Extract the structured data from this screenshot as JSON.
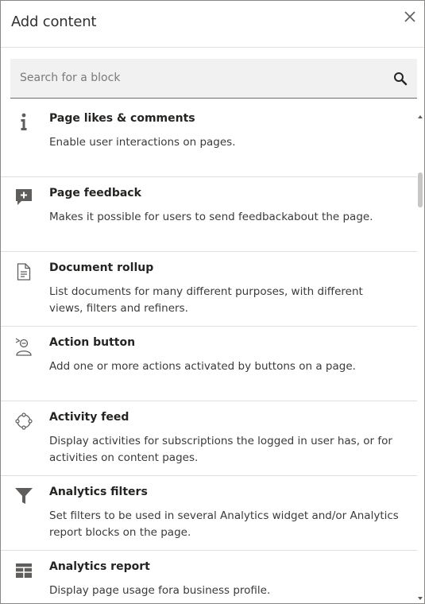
{
  "dialog": {
    "title": "Add content",
    "close_icon": "close-icon"
  },
  "search": {
    "placeholder": "Search for a block",
    "value": "",
    "icon": "search-icon"
  },
  "blocks": [
    {
      "name": "Page likes & comments",
      "description": "Enable user interactions on pages.",
      "icon": "info-icon"
    },
    {
      "name": "Page feedback",
      "description": "Makes it possible for users to send feedbackabout the page.",
      "icon": "comment-add-icon"
    },
    {
      "name": "Document rollup",
      "description": "List documents for many different purposes, with different views, filters and refiners.",
      "icon": "document-icon"
    },
    {
      "name": "Action button",
      "description": "Add one or more actions activated by buttons on a page.",
      "icon": "person-action-icon"
    },
    {
      "name": "Activity feed",
      "description": "Display activities for subscriptions the logged in user has, or for activities on content pages.",
      "icon": "network-icon"
    },
    {
      "name": "Analytics filters",
      "description": "Set filters to be used in several Analytics widget and/or Analytics report blocks on the page.",
      "icon": "filter-icon"
    },
    {
      "name": "Analytics report",
      "description": "Display page usage fora business profile.",
      "icon": "table-icon"
    }
  ],
  "colors": {
    "text": "#323130",
    "divider": "#e1dfdd",
    "search_bg": "#f1f1f1",
    "icon": "#605e5c"
  }
}
